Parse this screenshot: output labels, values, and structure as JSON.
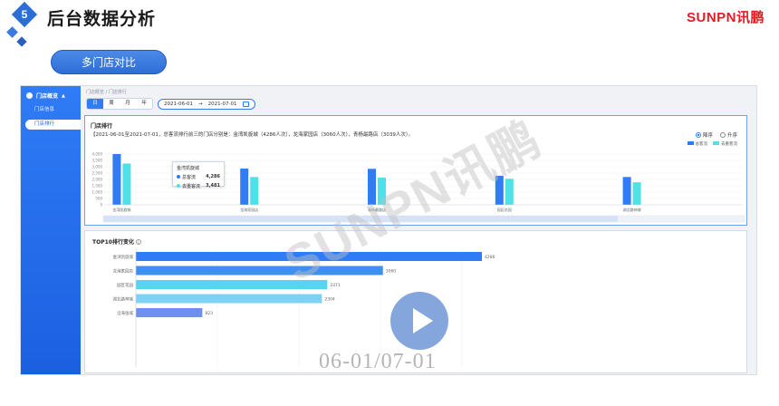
{
  "slide": {
    "step_number": "5",
    "title": "后台数据分析",
    "brand": "SUNPN讯鹏",
    "section_button": "多门店对比",
    "watermark": "SUNPN讯鹏",
    "timestamp": "06-01/07-01"
  },
  "sidebar": {
    "group_label": "门店概览",
    "items": [
      {
        "label": "门店信息"
      },
      {
        "label": "门店排行"
      }
    ]
  },
  "breadcrumb": {
    "parent": "门店概览",
    "separator": "/",
    "current": "门店排行"
  },
  "toolbar": {
    "period_tabs": [
      "日",
      "周",
      "月",
      "年"
    ],
    "active_period": "日",
    "date_start": "2021-06-01",
    "date_arrow": "→",
    "date_end": "2021-07-01"
  },
  "ranking_card": {
    "title": "门店排行",
    "description": "【2021-06-01至2021-07-01，总客流排行前三的门店分别是：金湾凯旋城（4286人次），龙海家园店（3060人次），青杨最路店（3039人次）。",
    "sort_desc": "降序",
    "sort_asc": "升序",
    "legend": [
      "总客流",
      "去重客流"
    ]
  },
  "tooltip": {
    "title": "金湾凯旋城",
    "rows": [
      {
        "label": "总客流",
        "value": "4,286"
      },
      {
        "label": "去重客流",
        "value": "3,481"
      }
    ]
  },
  "top_card": {
    "title": "TOP10排行变化",
    "info_icon": "i"
  },
  "colors": {
    "primary": "#2f7cf6",
    "secondary": "#4fe0e8",
    "bar_colors": [
      "#2f7cf6",
      "#3d8ff0",
      "#53d6ef",
      "#7fd0f5",
      "#6f8ef2"
    ]
  },
  "chart_data": [
    {
      "type": "bar",
      "title": "门店排行",
      "categories": [
        "金湾凯旋城",
        "龙海家园店",
        "青杨最路店",
        "园区花园",
        "湖北路神城"
      ],
      "series": [
        {
          "name": "总客流",
          "values": [
            4286,
            3060,
            3039,
            2450,
            2350
          ]
        },
        {
          "name": "去重客流",
          "values": [
            3481,
            2350,
            2300,
            2200,
            1900
          ]
        }
      ],
      "yticks": [
        "4,000",
        "3,500",
        "3,000",
        "2,500",
        "2,000",
        "1,500",
        "1,000",
        "500",
        "0"
      ],
      "ylim": [
        0,
        4286
      ],
      "legend": "top-right",
      "grid": true
    },
    {
      "type": "bar",
      "orientation": "horizontal",
      "title": "TOP10排行变化",
      "categories": [
        "金湾凯旋城",
        "龙海家园店",
        "园区花园",
        "湖北路神城",
        "沿海张城"
      ],
      "values": [
        4286,
        3060,
        2371,
        2304,
        823
      ],
      "xlim": [
        0,
        4286
      ],
      "grid": true
    }
  ]
}
